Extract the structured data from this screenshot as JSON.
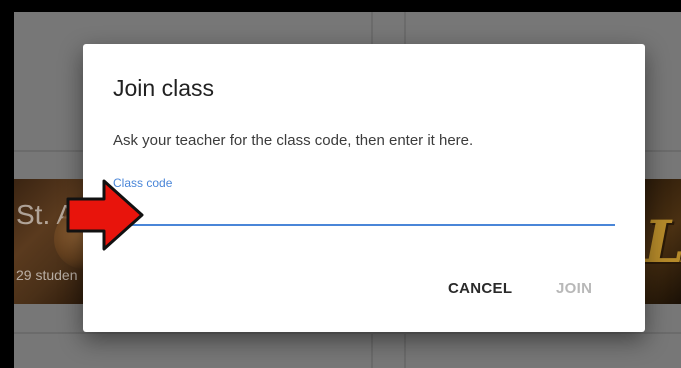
{
  "background": {
    "left_card": {
      "title": "St. A",
      "subtitle": "29 studen"
    },
    "right_card": {
      "logo_text": "LA"
    }
  },
  "dialog": {
    "title": "Join class",
    "description": "Ask your teacher for the class code, then enter it here.",
    "field": {
      "label": "Class code",
      "value": "",
      "placeholder": ""
    },
    "buttons": {
      "cancel": "CANCEL",
      "join": "JOIN"
    }
  },
  "annotation": {
    "arrow_icon": "red-arrow-icon",
    "arrow_color": "#e8140c"
  },
  "colors": {
    "accent": "#4a86d8",
    "disabled": "#b8b8b8",
    "overlay": "#777777"
  }
}
